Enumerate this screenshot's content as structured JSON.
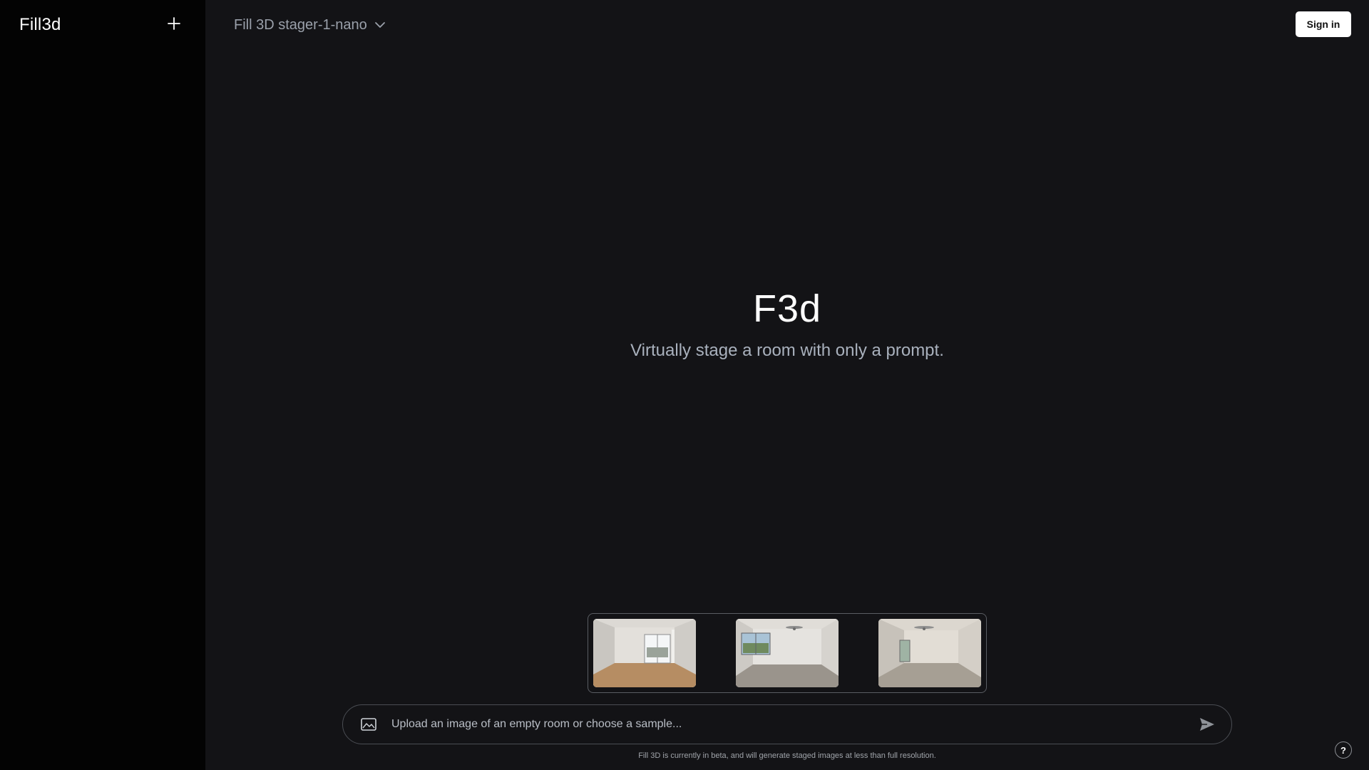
{
  "sidebar": {
    "brand": "Fill3d",
    "new_icon": "plus-icon"
  },
  "header": {
    "model_label": "Fill 3D stager-1-nano",
    "model_icon": "chevron-down-icon",
    "signin_label": "Sign in"
  },
  "hero": {
    "logo": "F3d",
    "subtitle": "Virtually stage a room with only a prompt."
  },
  "samples": [
    {
      "name": "sample-room-1"
    },
    {
      "name": "sample-room-2"
    },
    {
      "name": "sample-room-3"
    }
  ],
  "prompt": {
    "image_icon": "image-icon",
    "placeholder": "Upload an image of an empty room or choose a sample...",
    "send_icon": "send-icon"
  },
  "footer": {
    "disclaimer": "Fill 3D is currently in beta, and will generate staged images at less than full resolution.",
    "help_label": "?"
  },
  "colors": {
    "background": "#131316",
    "sidebar": "#030303",
    "accent_text": "#a9b1bd"
  }
}
